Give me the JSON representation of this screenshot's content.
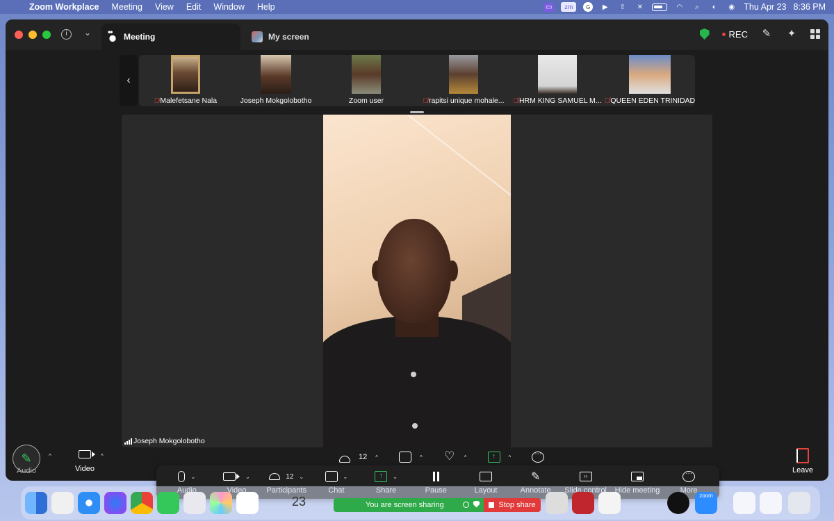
{
  "menubar": {
    "app_name": "Zoom Workplace",
    "menus": [
      "Meeting",
      "View",
      "Edit",
      "Window",
      "Help"
    ],
    "date": "Thu Apr 23",
    "time": "8:36 PM",
    "zoom_status_text": "zm"
  },
  "window": {
    "tabs": [
      {
        "label": "Meeting",
        "icon": "meeting-paw-icon",
        "active": true
      },
      {
        "label": "My screen",
        "icon": "screen-thumbnail-icon",
        "active": false
      }
    ],
    "rec_label": "REC",
    "security_color": "#27b54d"
  },
  "participants_strip": [
    {
      "name": "Malefetsane Nala",
      "muted": true
    },
    {
      "name": "Joseph Mokgolobotho",
      "muted": false
    },
    {
      "name": "Zoom user",
      "muted": false
    },
    {
      "name": "rapitsi unique mohale...",
      "muted": true
    },
    {
      "name": "HRM KING SAMUEL M...",
      "muted": true
    },
    {
      "name": "QUEEN EDEN TRINIDAD",
      "muted": true
    }
  ],
  "active_speaker": {
    "name": "Joseph Mokgolobotho"
  },
  "stage_tools": {
    "participants_count": "12"
  },
  "left_controls": {
    "audio_label": "Audio",
    "video_label": "Video"
  },
  "leave_label": "Leave",
  "share_toolbar": {
    "items": [
      {
        "label": "Audio",
        "icon": "microphone-icon"
      },
      {
        "label": "Video",
        "icon": "video-camera-icon"
      },
      {
        "label": "Participants",
        "icon": "participants-icon",
        "count": "12"
      },
      {
        "label": "Chat",
        "icon": "chat-bubble-icon"
      },
      {
        "label": "Share",
        "icon": "share-screen-icon"
      },
      {
        "label": "Pause",
        "icon": "pause-icon"
      },
      {
        "label": "Layout",
        "icon": "layout-icon"
      },
      {
        "label": "Annotate",
        "icon": "pencil-icon"
      },
      {
        "label": "Slide control",
        "icon": "slide-control-icon"
      },
      {
        "label": "Hide meeting",
        "icon": "hide-meeting-icon"
      },
      {
        "label": "More",
        "icon": "more-icon"
      }
    ]
  },
  "share_status": {
    "sharing_text": "You are screen sharing",
    "stop_label": "Stop share"
  },
  "dock": {
    "calendar_day": "23",
    "zoom_label": "zoom"
  },
  "colors": {
    "accent_green": "#35c25f",
    "danger_red": "#e5443a",
    "dock_bg": "#dce4f8"
  }
}
